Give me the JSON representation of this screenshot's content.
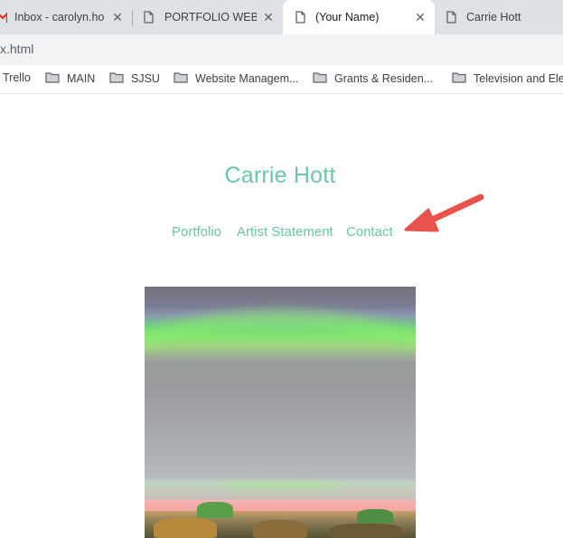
{
  "browser": {
    "tabs": [
      {
        "title": "Inbox - carolyn.ho",
        "icon": "gmail-icon",
        "active": false
      },
      {
        "title": "PORTFOLIO WEBS",
        "icon": "page-icon",
        "active": false
      },
      {
        "title": "(Your Name)",
        "icon": "page-icon",
        "active": true
      },
      {
        "title": "Carrie Hott",
        "icon": "page-icon",
        "active": false
      }
    ],
    "close_glyph": "✕",
    "url": "x.html",
    "bookmarks": [
      {
        "label": "Trello",
        "icon": "trello-icon"
      },
      {
        "label": "MAIN",
        "icon": "folder-icon"
      },
      {
        "label": "SJSU",
        "icon": "folder-icon"
      },
      {
        "label": "Website Managem...",
        "icon": "folder-icon"
      },
      {
        "label": "Grants & Residen...",
        "icon": "folder-icon"
      },
      {
        "label": "Television and Ele",
        "icon": "folder-icon"
      }
    ]
  },
  "page": {
    "site_title": "Carrie Hott",
    "nav": [
      "Portfolio",
      "Artist Statement",
      "Contact"
    ],
    "annotation": {
      "icon": "red-arrow-icon",
      "color": "#e8544b",
      "points_to": "Contact"
    },
    "hero_image": {
      "description_icon": "landscape-painting-image"
    }
  },
  "colors": {
    "accent": "#6ac6a7",
    "tab_strip": "#dee1e6",
    "omnibox": "#f1f3f4"
  }
}
